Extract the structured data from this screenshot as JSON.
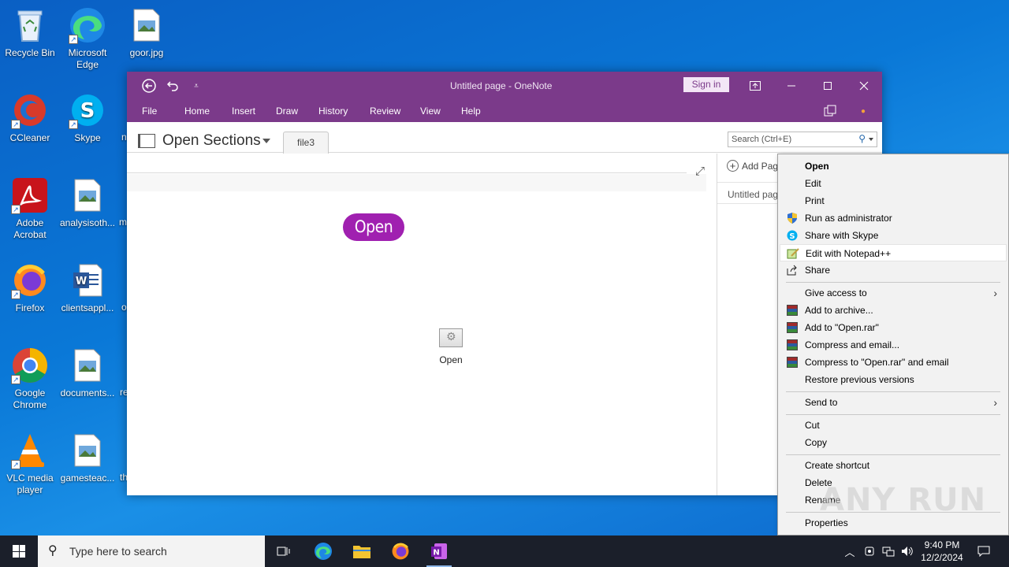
{
  "desktop": {
    "icons": [
      {
        "label": "Recycle Bin"
      },
      {
        "label": "Microsoft Edge"
      },
      {
        "label": "goor.jpg"
      },
      {
        "label": "CCleaner"
      },
      {
        "label": "Skype"
      },
      {
        "label": "Adobe Acrobat"
      },
      {
        "label": "analysisoth..."
      },
      {
        "label": "Firefox"
      },
      {
        "label": "clientsappl..."
      },
      {
        "label": "Google Chrome"
      },
      {
        "label": "documents..."
      },
      {
        "label": "VLC media player"
      },
      {
        "label": "gamesteac..."
      }
    ],
    "peeks": [
      "n",
      "m",
      "o",
      "re",
      "th"
    ]
  },
  "onenote": {
    "window_title": "Untitled page  -  OneNote",
    "sign_in": "Sign in",
    "ribbon_tabs": [
      "File",
      "Home",
      "Insert",
      "Draw",
      "History",
      "Review",
      "View",
      "Help"
    ],
    "notebook_title": "Open Sections",
    "section_tab": "file3",
    "search_placeholder": "Search (Ctrl+E)",
    "add_page": "Add Pag",
    "page_entry": "Untitled pag",
    "pill_text": "Open",
    "file_object_label": "Open"
  },
  "context_menu": {
    "items": [
      {
        "label": "Open",
        "icon": ""
      },
      {
        "label": "Edit",
        "icon": ""
      },
      {
        "label": "Print",
        "icon": ""
      },
      {
        "label": "Run as administrator",
        "icon": "shield-icon"
      },
      {
        "label": "Share with Skype",
        "icon": "skype-icon"
      },
      {
        "label": "Edit with Notepad++",
        "icon": "notepadpp-icon"
      },
      {
        "label": "Share",
        "icon": "share-icon"
      },
      {
        "label": "Give access to",
        "icon": ""
      },
      {
        "label": "Add to archive...",
        "icon": "winrar-icon"
      },
      {
        "label": "Add to \"Open.rar\"",
        "icon": "winrar-icon"
      },
      {
        "label": "Compress and email...",
        "icon": "winrar-icon"
      },
      {
        "label": "Compress to \"Open.rar\" and email",
        "icon": "winrar-icon"
      },
      {
        "label": "Restore previous versions",
        "icon": ""
      },
      {
        "label": "Send to",
        "icon": ""
      },
      {
        "label": "Cut",
        "icon": ""
      },
      {
        "label": "Copy",
        "icon": ""
      },
      {
        "label": "Create shortcut",
        "icon": ""
      },
      {
        "label": "Delete",
        "icon": ""
      },
      {
        "label": "Rename",
        "icon": ""
      },
      {
        "label": "Properties",
        "icon": ""
      }
    ],
    "highlighted": "Edit with Notepad++"
  },
  "watermark": "ANY RUN",
  "taskbar": {
    "search_placeholder": "Type here to search",
    "time": "9:40 PM",
    "date": "12/2/2024"
  },
  "colors": {
    "onenote_purple": "#7b3a8a",
    "pill_purple": "#a020b0",
    "taskbar": "#1b1f2a"
  }
}
